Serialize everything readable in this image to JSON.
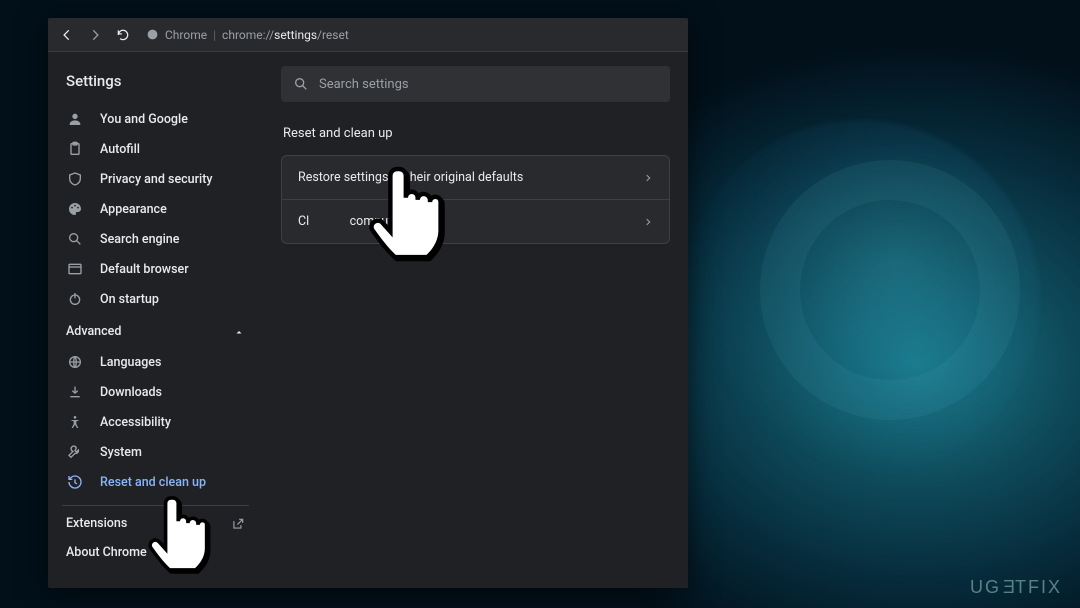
{
  "address_bar": {
    "app_name": "Chrome",
    "url_prefix": "chrome://",
    "url_mid": "settings",
    "url_suffix": "/reset"
  },
  "sidebar": {
    "title": "Settings",
    "items": [
      {
        "label": "You and Google"
      },
      {
        "label": "Autofill"
      },
      {
        "label": "Privacy and security"
      },
      {
        "label": "Appearance"
      },
      {
        "label": "Search engine"
      },
      {
        "label": "Default browser"
      },
      {
        "label": "On startup"
      }
    ],
    "advanced_label": "Advanced",
    "advanced_items": [
      {
        "label": "Languages"
      },
      {
        "label": "Downloads"
      },
      {
        "label": "Accessibility"
      },
      {
        "label": "System"
      },
      {
        "label": "Reset and clean up"
      }
    ],
    "footer": {
      "extensions": "Extensions",
      "about": "About Chrome"
    }
  },
  "search": {
    "placeholder": "Search settings"
  },
  "main": {
    "section_title": "Reset and clean up",
    "rows": [
      {
        "label": "Restore settings to their original defaults"
      },
      {
        "label_before": "Cl",
        "label_after": "computer"
      }
    ]
  },
  "watermark": {
    "pre": "UG",
    "mid": "E",
    "post": "TFIX"
  }
}
